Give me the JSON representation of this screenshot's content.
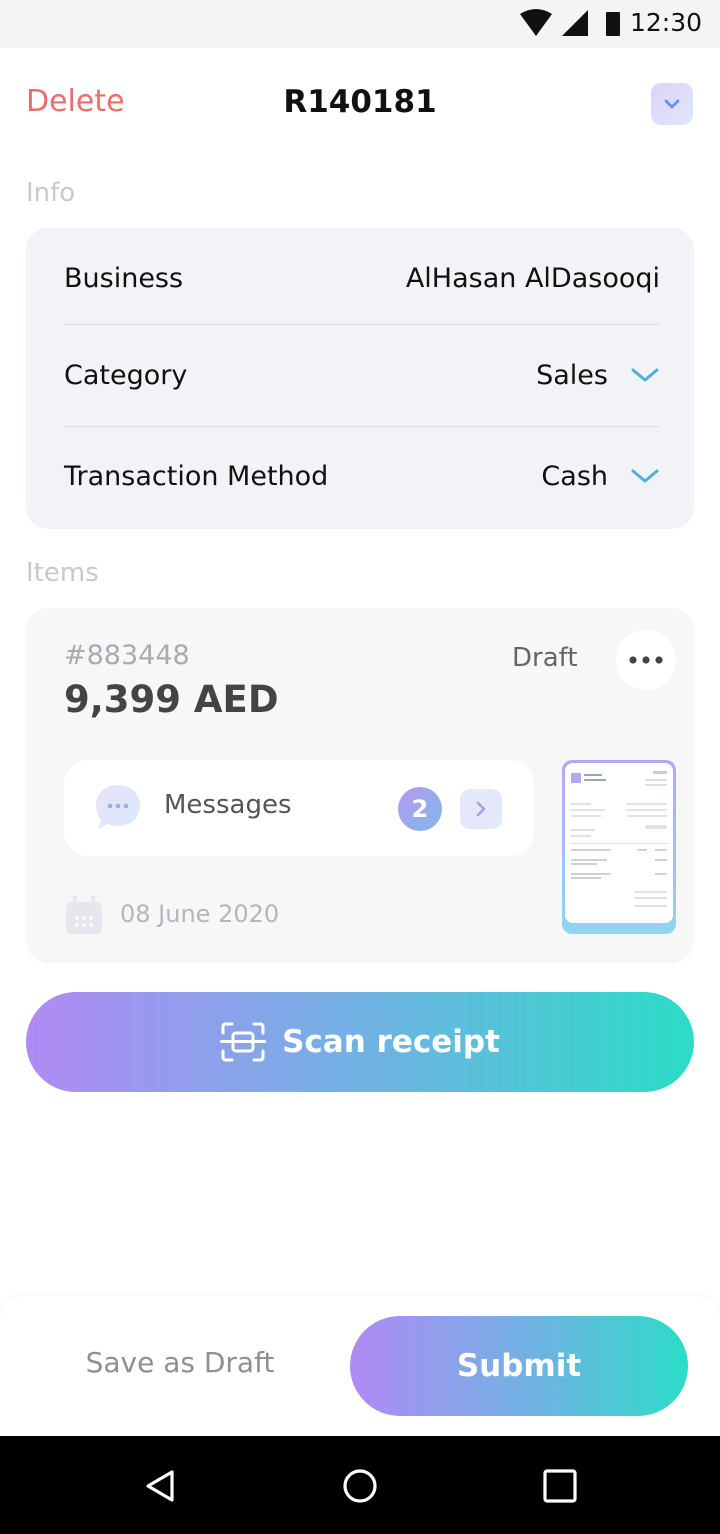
{
  "status_bar": {
    "time": "12:30",
    "icons": [
      "wifi-icon",
      "cellular-signal-icon",
      "battery-icon"
    ]
  },
  "header": {
    "delete_label": "Delete",
    "title": "R140181",
    "collapse_icon": "chevron-down-icon"
  },
  "info": {
    "section_label": "Info",
    "rows": [
      {
        "label": "Business",
        "value": "AlHasan AlDasooqi"
      },
      {
        "label": "Category",
        "value": "Sales",
        "icon": "chevron-down-icon"
      },
      {
        "label": "Transaction Method",
        "value": "Cash",
        "icon": "chevron-down-icon"
      }
    ]
  },
  "items": {
    "section_label": "Items",
    "card": {
      "id": "#883448",
      "amount": "9,399 AED",
      "status": "Draft",
      "messages_label": "Messages",
      "messages_count": "2",
      "date": "08 June 2020"
    }
  },
  "scan_button": {
    "label": "Scan receipt",
    "icon": "scan-icon"
  },
  "footer": {
    "draft_label": "Save as Draft",
    "submit_label": "Submit"
  },
  "colors": {
    "delete": "#ec6d6d",
    "gradient_start": "#b08af5",
    "gradient_end": "#2bdcc7",
    "chevron": "#4fb0d9"
  },
  "nav_bar": {
    "icons": [
      "back-icon",
      "home-icon",
      "recents-icon"
    ]
  }
}
